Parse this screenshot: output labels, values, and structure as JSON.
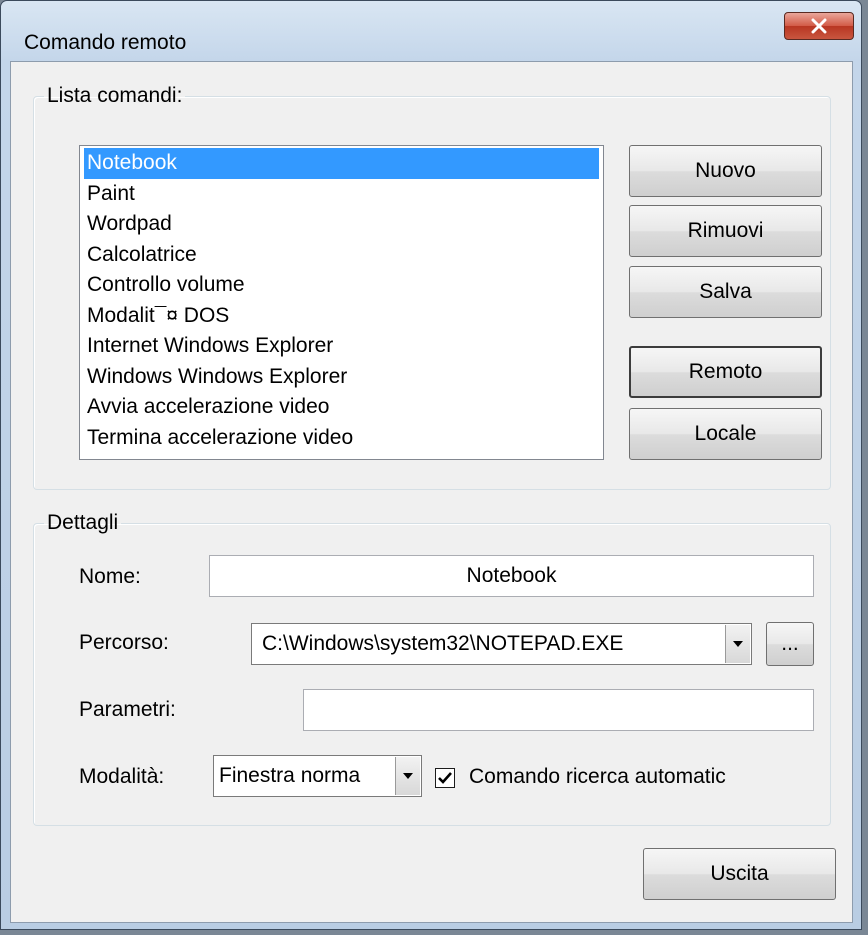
{
  "window": {
    "title": "Comando remoto",
    "close_glyph": "X"
  },
  "commands_group": {
    "legend": "Lista comandi:",
    "items": [
      "Notebook",
      "Paint",
      "Wordpad",
      "Calcolatrice",
      "Controllo volume",
      "Modalit¯¤ DOS",
      "Internet Windows Explorer",
      "Windows Windows Explorer",
      "Avvia accelerazione video",
      "Termina accelerazione video"
    ],
    "selected_index": 0,
    "buttons": {
      "new": "Nuovo",
      "remove": "Rimuovi",
      "save": "Salva",
      "remote": "Remoto",
      "local": "Locale"
    }
  },
  "details_group": {
    "legend": "Dettagli",
    "name_label": "Nome:",
    "name_value": "Notebook",
    "path_label": "Percorso:",
    "path_value": "C:\\Windows\\system32\\NOTEPAD.EXE",
    "browse_label": "...",
    "params_label": "Parametri:",
    "params_value": "",
    "mode_label": "Modalità:",
    "mode_value": "Finestra norma",
    "auto_search_label": "Comando ricerca automatic",
    "auto_search_checked": true
  },
  "footer": {
    "exit_label": "Uscita"
  },
  "icons": {
    "close": "close-icon",
    "dropdown": "chevron-down-icon",
    "check": "checkmark-icon"
  }
}
